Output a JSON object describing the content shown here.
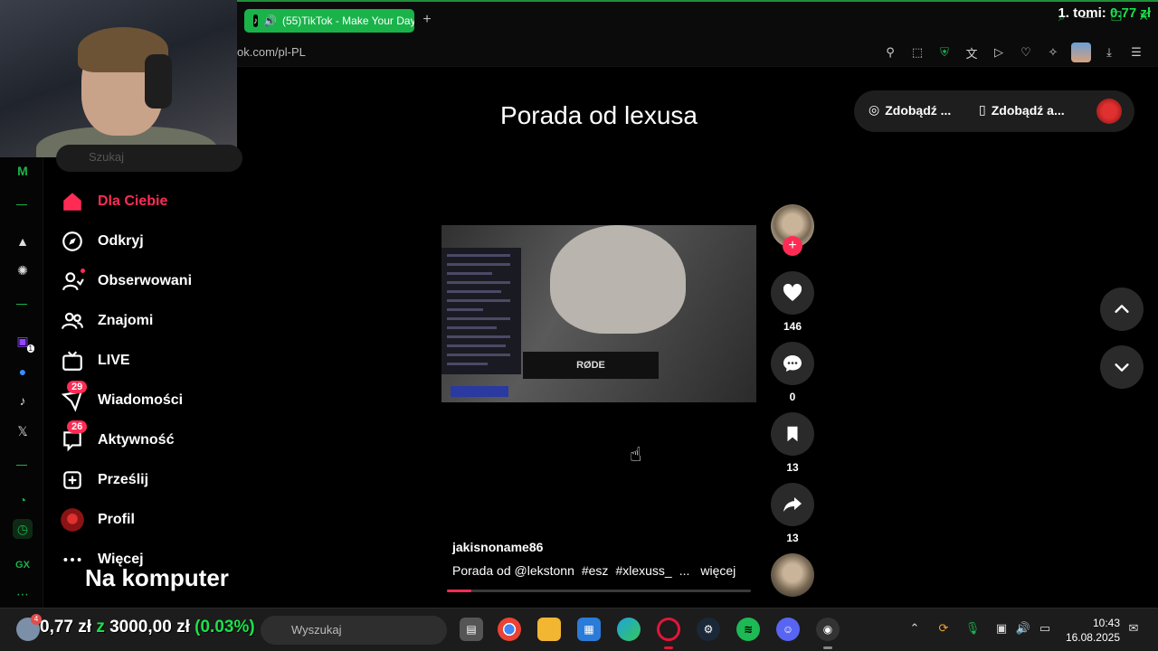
{
  "browser": {
    "tab_title": "(55)TikTok - Make Your Day",
    "new_tab": "+",
    "url": "ok.com/pl-PL"
  },
  "stream_overlay": {
    "label": "1. tomi:",
    "value": "0.77 zł"
  },
  "sidebar": {
    "search_placeholder": "Szukaj",
    "items": [
      {
        "label": "Dla Ciebie",
        "icon": "home-icon",
        "active": true
      },
      {
        "label": "Odkryj",
        "icon": "compass-icon"
      },
      {
        "label": "Obserwowani",
        "icon": "following-icon"
      },
      {
        "label": "Znajomi",
        "icon": "friends-icon"
      },
      {
        "label": "LIVE",
        "icon": "live-tv-icon"
      },
      {
        "label": "Wiadomości",
        "icon": "messages-icon",
        "badge": "29"
      },
      {
        "label": "Aktywność",
        "icon": "activity-icon",
        "badge": "26"
      },
      {
        "label": "Prześlij",
        "icon": "upload-icon"
      },
      {
        "label": "Profil",
        "icon": "profile-avatar-icon"
      },
      {
        "label": "Więcej",
        "icon": "more-dots-icon"
      }
    ],
    "overlay_text": "Na komputer"
  },
  "video": {
    "title": "Porada od lexusa",
    "author": "jakisnoname86",
    "description": "Porada od @lekstonn",
    "tags": [
      "#esz",
      "#xlexuss_",
      "..."
    ],
    "more_label": "więcej",
    "mic_brand": "RØDE",
    "progress_fraction": 0.08
  },
  "actions": {
    "likes": "146",
    "comments": "0",
    "saves": "13",
    "shares": "13",
    "follow_symbol": "+"
  },
  "header": {
    "pill_1": "Zdobądź ...",
    "pill_2": "Zdobądź a..."
  },
  "taskbar": {
    "weather_badge": "4",
    "money_left": "0,77 zł",
    "money_mid": "z",
    "money_total": "3000,00 zł",
    "money_pct": "(0.03%)",
    "search_placeholder": "Wyszukaj",
    "time": "10:43",
    "date": "16.08.2025"
  },
  "colors": {
    "accent_tiktok": "#fe2c55",
    "accent_opera_gx": "#19b34a",
    "background": "#000000"
  }
}
